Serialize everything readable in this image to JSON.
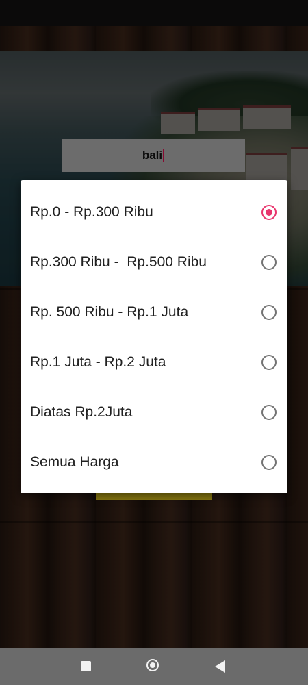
{
  "search": {
    "value": "bali"
  },
  "price_dialog": {
    "options": [
      {
        "label": "Rp.0 - Rp.300 Ribu",
        "selected": true
      },
      {
        "label": "Rp.300 Ribu -  Rp.500 Ribu",
        "selected": false
      },
      {
        "label": "Rp. 500 Ribu - Rp.1 Juta",
        "selected": false
      },
      {
        "label": "Rp.1 Juta - Rp.2 Juta",
        "selected": false
      },
      {
        "label": "Diatas Rp.2Juta",
        "selected": false
      },
      {
        "label": "Semua Harga",
        "selected": false
      }
    ]
  },
  "colors": {
    "accent": "#e8356d",
    "search_bg": "#a6a6a6",
    "nav_bar": "#6b6b6b"
  },
  "icons": {
    "nav_recents": "square-icon",
    "nav_home": "home-circle-icon",
    "nav_back": "back-triangle-icon"
  }
}
